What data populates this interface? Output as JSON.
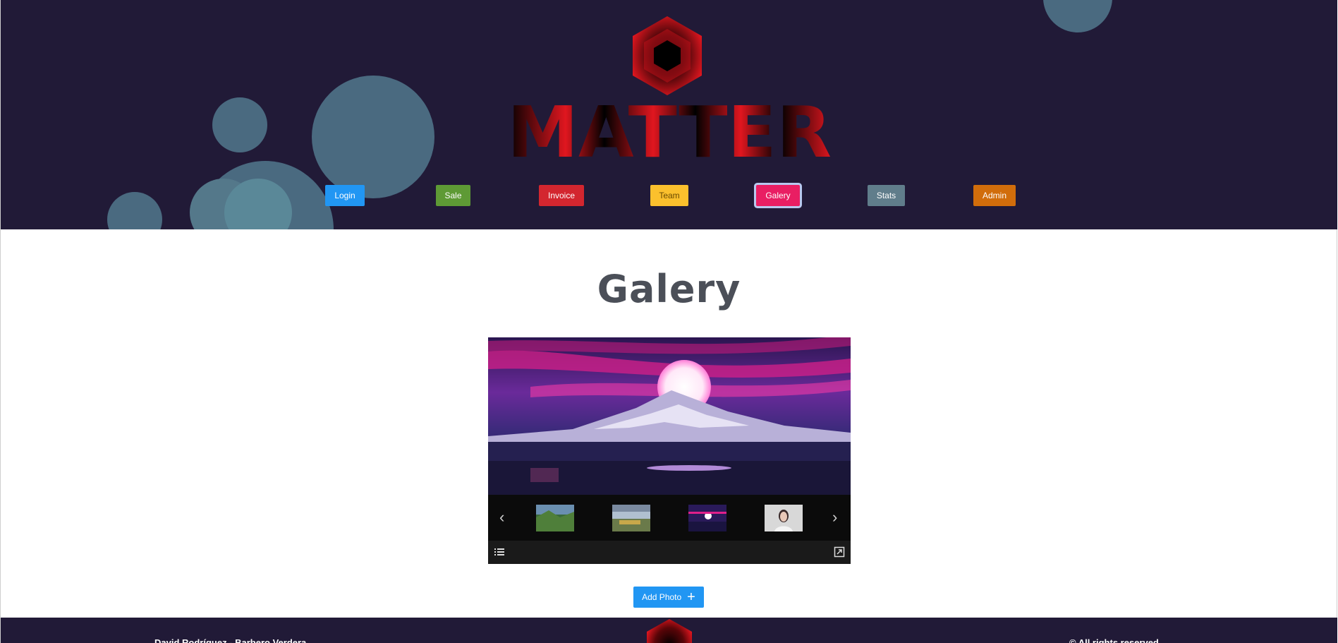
{
  "header": {
    "logo_text": "MATTER",
    "nav": [
      {
        "label": "Login",
        "color": "#2196f3"
      },
      {
        "label": "Sale",
        "color": "#5e9a35"
      },
      {
        "label": "Invoice",
        "color": "#d3262f"
      },
      {
        "label": "Team",
        "color": "#fbc02d"
      },
      {
        "label": "Galery",
        "color": "#e91e63",
        "active": true
      },
      {
        "label": "Stats",
        "color": "#607d8b"
      },
      {
        "label": "Admin",
        "color": "#d16d0b"
      }
    ]
  },
  "main": {
    "title": "Galery",
    "gallery": {
      "icons": [
        "chevron-left-icon",
        "chevron-right-icon",
        "list-icon",
        "fullscreen-icon"
      ]
    },
    "add_photo_label": "Add Photo"
  },
  "footer": {
    "left_text": "David Rodríguez - Barbero Verdera",
    "right_text": "© All rights reserved"
  },
  "colors": {
    "header_bg": "#211a37",
    "bubble": "#4a6a80",
    "bubble_light": "#5fd4e6",
    "logo_red": "#e0161f",
    "title": "#4b4f58",
    "button_blue": "#2196f3"
  }
}
